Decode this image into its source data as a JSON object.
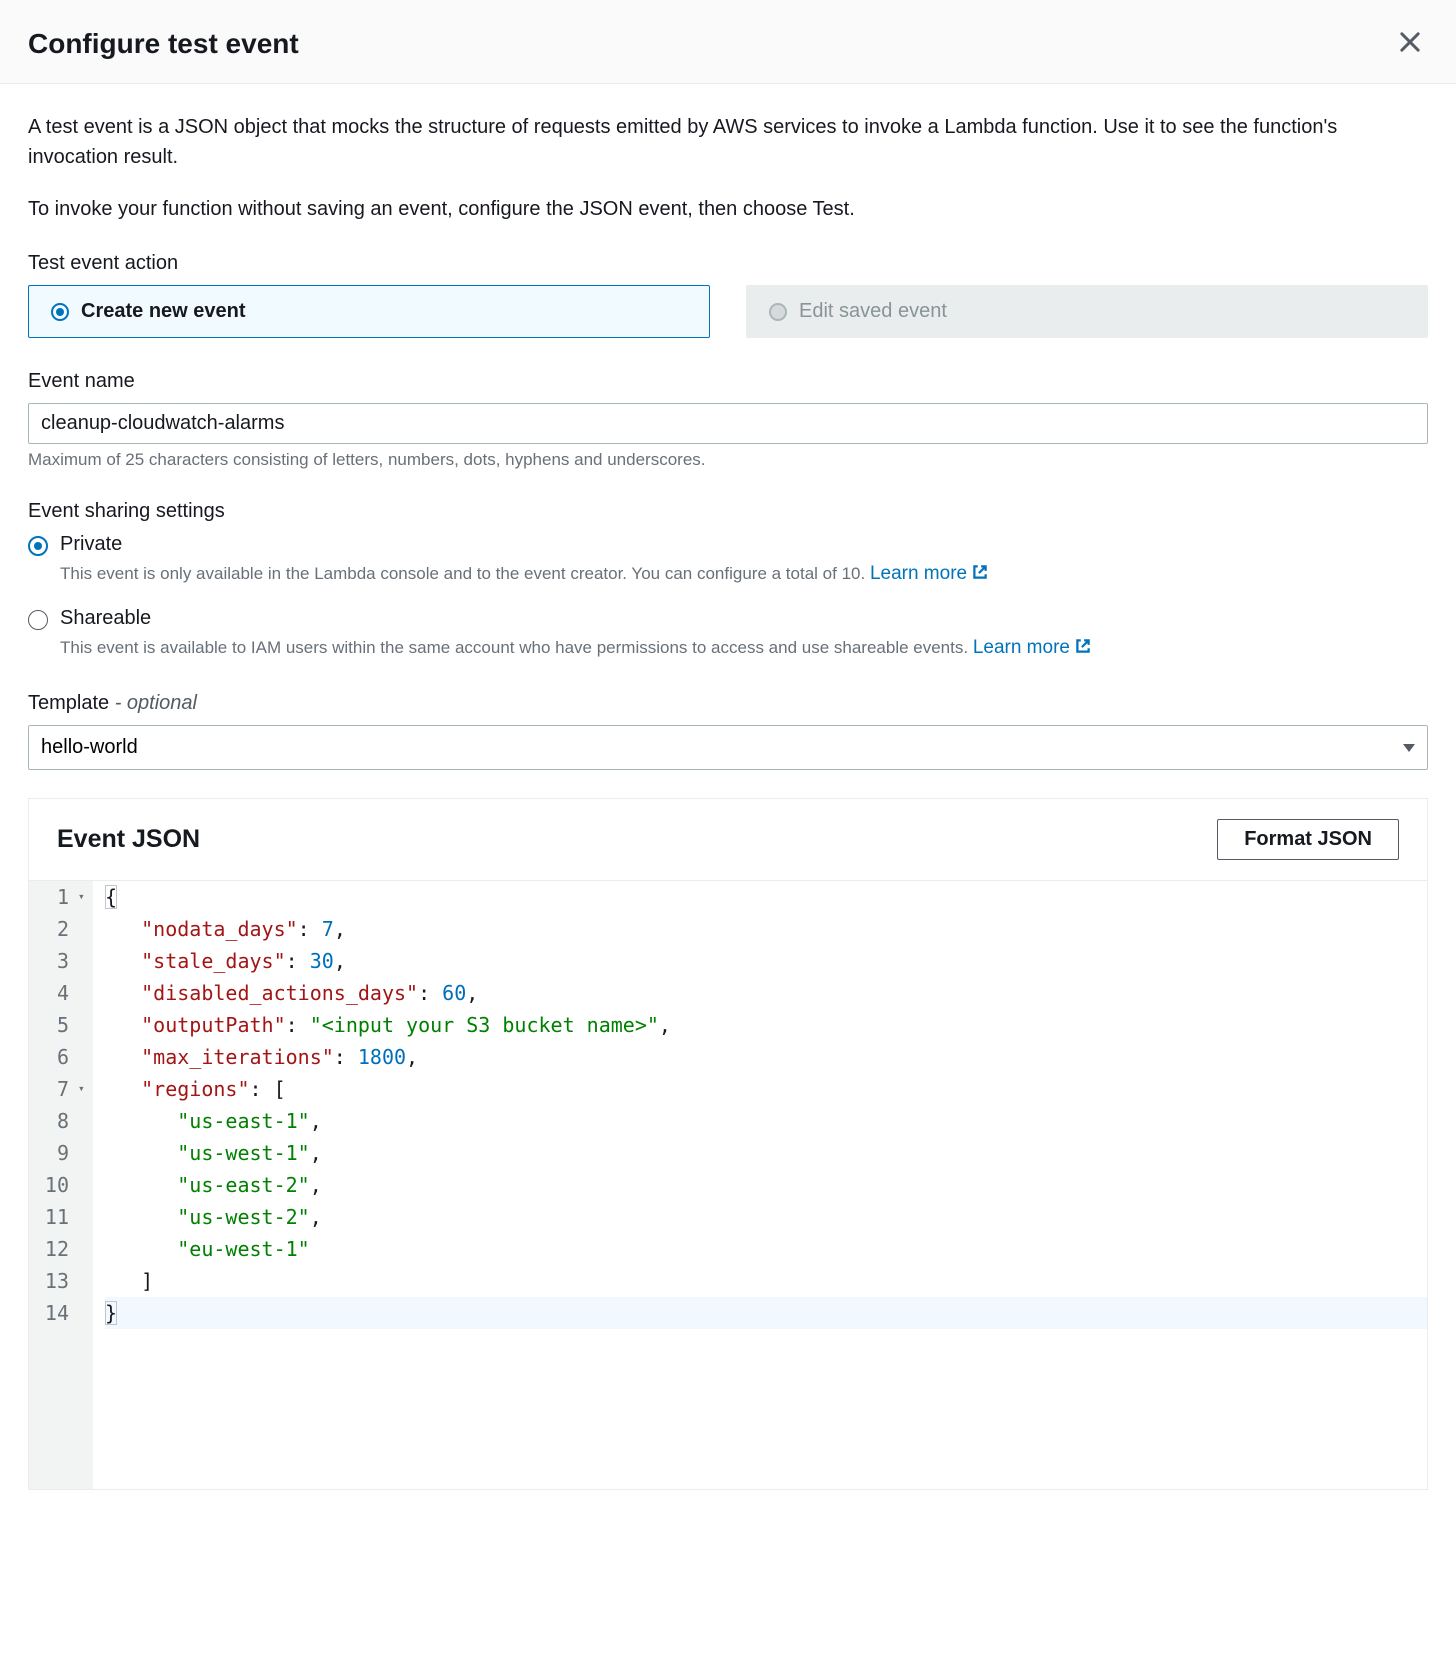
{
  "header": {
    "title": "Configure test event"
  },
  "intro": {
    "p1": "A test event is a JSON object that mocks the structure of requests emitted by AWS services to invoke a Lambda function. Use it to see the function's invocation result.",
    "p2": "To invoke your function without saving an event, configure the JSON event, then choose Test."
  },
  "action": {
    "label": "Test event action",
    "create": "Create new event",
    "edit": "Edit saved event"
  },
  "eventName": {
    "label": "Event name",
    "value": "cleanup-cloudwatch-alarms",
    "hint": "Maximum of 25 characters consisting of letters, numbers, dots, hyphens and underscores."
  },
  "sharing": {
    "label": "Event sharing settings",
    "private": {
      "label": "Private",
      "desc": "This event is only available in the Lambda console and to the event creator. You can configure a total of 10. ",
      "learn": "Learn more"
    },
    "shareable": {
      "label": "Shareable",
      "desc": "This event is available to IAM users within the same account who have permissions to access and use shareable events. ",
      "learn": "Learn more"
    }
  },
  "template": {
    "label": "Template",
    "optional": " - optional",
    "value": "hello-world"
  },
  "jsonPanel": {
    "title": "Event JSON",
    "formatBtn": "Format JSON"
  },
  "eventJson": {
    "nodata_days": 7,
    "stale_days": 30,
    "disabled_actions_days": 60,
    "outputPath": "<input your S3 bucket name>",
    "max_iterations": 1800,
    "regions": [
      "us-east-1",
      "us-west-1",
      "us-east-2",
      "us-west-2",
      "eu-west-1"
    ]
  },
  "editorLines": [
    {
      "n": 1,
      "fold": true,
      "tokens": [
        {
          "t": "{",
          "c": "brace boxed"
        }
      ]
    },
    {
      "n": 2,
      "tokens": [
        {
          "t": "   ",
          "c": ""
        },
        {
          "t": "\"nodata_days\"",
          "c": "key"
        },
        {
          "t": ": ",
          "c": "punct"
        },
        {
          "t": "7",
          "c": "num"
        },
        {
          "t": ",",
          "c": "punct"
        }
      ]
    },
    {
      "n": 3,
      "tokens": [
        {
          "t": "   ",
          "c": ""
        },
        {
          "t": "\"stale_days\"",
          "c": "key"
        },
        {
          "t": ": ",
          "c": "punct"
        },
        {
          "t": "30",
          "c": "num"
        },
        {
          "t": ",",
          "c": "punct"
        }
      ]
    },
    {
      "n": 4,
      "tokens": [
        {
          "t": "   ",
          "c": ""
        },
        {
          "t": "\"disabled_actions_days\"",
          "c": "key"
        },
        {
          "t": ": ",
          "c": "punct"
        },
        {
          "t": "60",
          "c": "num"
        },
        {
          "t": ",",
          "c": "punct"
        }
      ]
    },
    {
      "n": 5,
      "tokens": [
        {
          "t": "   ",
          "c": ""
        },
        {
          "t": "\"outputPath\"",
          "c": "key"
        },
        {
          "t": ": ",
          "c": "punct"
        },
        {
          "t": "\"<input your S3 bucket name>\"",
          "c": "str"
        },
        {
          "t": ",",
          "c": "punct"
        }
      ]
    },
    {
      "n": 6,
      "tokens": [
        {
          "t": "   ",
          "c": ""
        },
        {
          "t": "\"max_iterations\"",
          "c": "key"
        },
        {
          "t": ": ",
          "c": "punct"
        },
        {
          "t": "1800",
          "c": "num"
        },
        {
          "t": ",",
          "c": "punct"
        }
      ]
    },
    {
      "n": 7,
      "fold": true,
      "tokens": [
        {
          "t": "   ",
          "c": ""
        },
        {
          "t": "\"regions\"",
          "c": "key"
        },
        {
          "t": ": ",
          "c": "punct"
        },
        {
          "t": "[",
          "c": "brace"
        }
      ]
    },
    {
      "n": 8,
      "tokens": [
        {
          "t": "      ",
          "c": ""
        },
        {
          "t": "\"us-east-1\"",
          "c": "str"
        },
        {
          "t": ",",
          "c": "punct"
        }
      ]
    },
    {
      "n": 9,
      "tokens": [
        {
          "t": "      ",
          "c": ""
        },
        {
          "t": "\"us-west-1\"",
          "c": "str"
        },
        {
          "t": ",",
          "c": "punct"
        }
      ]
    },
    {
      "n": 10,
      "tokens": [
        {
          "t": "      ",
          "c": ""
        },
        {
          "t": "\"us-east-2\"",
          "c": "str"
        },
        {
          "t": ",",
          "c": "punct"
        }
      ]
    },
    {
      "n": 11,
      "tokens": [
        {
          "t": "      ",
          "c": ""
        },
        {
          "t": "\"us-west-2\"",
          "c": "str"
        },
        {
          "t": ",",
          "c": "punct"
        }
      ]
    },
    {
      "n": 12,
      "tokens": [
        {
          "t": "      ",
          "c": ""
        },
        {
          "t": "\"eu-west-1\"",
          "c": "str"
        }
      ]
    },
    {
      "n": 13,
      "tokens": [
        {
          "t": "   ",
          "c": ""
        },
        {
          "t": "]",
          "c": "brace"
        }
      ]
    },
    {
      "n": 14,
      "hl": true,
      "tokens": [
        {
          "t": "}",
          "c": "brace boxed"
        }
      ]
    }
  ]
}
